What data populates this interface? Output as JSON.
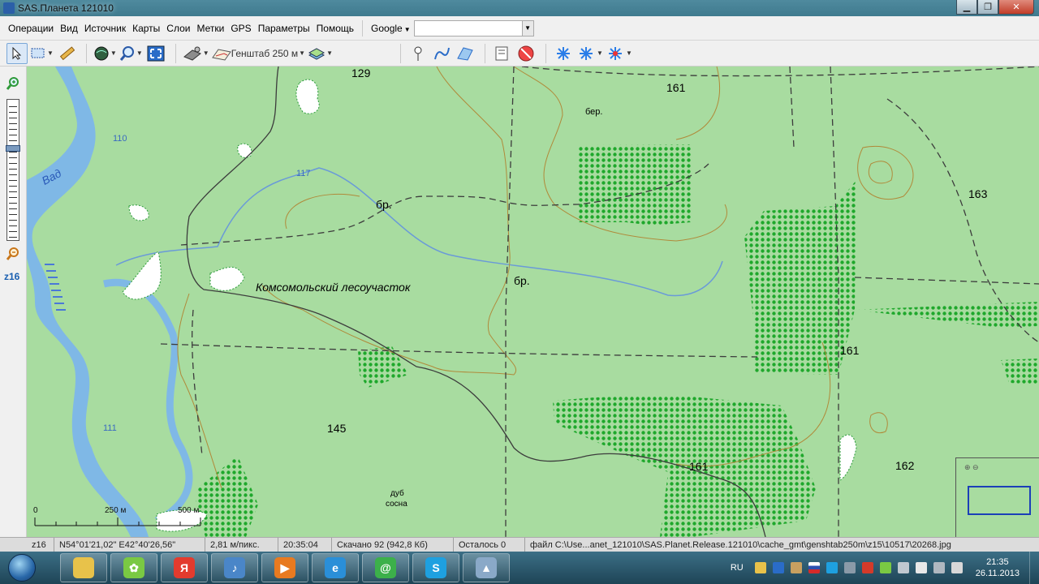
{
  "window": {
    "title": "SAS.Планета 121010"
  },
  "menu": {
    "items": [
      "Операции",
      "Вид",
      "Источник",
      "Карты",
      "Слои",
      "Метки",
      "GPS",
      "Параметры",
      "Помощь"
    ],
    "search_provider": "Google",
    "search_value": ""
  },
  "toolbar": {
    "map_type": "Генштаб 250 м",
    "icons": [
      "cursor-icon",
      "select-area-icon",
      "ruler-icon",
      "globe-icon",
      "zoom-lens-icon",
      "fullscreen-icon",
      "satellite-icon",
      "map-sheet-icon",
      "layers-icon",
      "placemark-icon",
      "path-icon",
      "polygon-icon",
      "marks-list-icon",
      "hide-marks-icon",
      "gps-icon",
      "gps-track-icon",
      "gps-settings-icon"
    ]
  },
  "side": {
    "zoom_label": "z16"
  },
  "map": {
    "labels": {
      "h129": "129",
      "h161a": "161",
      "h163": "163",
      "h161b": "161",
      "h161c": "161",
      "h162": "162",
      "h145": "145",
      "h110": "110",
      "h117": "117",
      "h111": "111",
      "river": "Вад",
      "ber": "бер.",
      "br1": "бр.",
      "br2": "бр.",
      "forest": "Комсомольский лесоучасток",
      "dub": "дуб",
      "sosna": "сосна"
    },
    "scale": {
      "zero": "0",
      "mid": "250 м",
      "end": "500 м"
    }
  },
  "status": {
    "zoom": "z16",
    "coords": "N54°01'21,02\" E42°40'26,56\"",
    "resolution": "2,81 м/пикс.",
    "time": "20:35:04",
    "downloaded": "Скачано 92 (942,8 Кб)",
    "remaining": "Осталось 0",
    "file": "файл C:\\Use...anet_121010\\SAS.Planet.Release.121010\\cache_gmt\\genshtab250m\\z15\\10517\\20268.jpg"
  },
  "taskbar": {
    "apps": [
      {
        "name": "explorer",
        "color": "#e8c24a",
        "glyph": ""
      },
      {
        "name": "icq",
        "color": "#7ac943",
        "glyph": "✿"
      },
      {
        "name": "yandex",
        "color": "#e33b2e",
        "glyph": "Я"
      },
      {
        "name": "audio",
        "color": "#4a86c8",
        "glyph": "♪"
      },
      {
        "name": "media",
        "color": "#e87a20",
        "glyph": "▶"
      },
      {
        "name": "ie",
        "color": "#2a8fd8",
        "glyph": "e"
      },
      {
        "name": "qip",
        "color": "#3cb04a",
        "glyph": "@"
      },
      {
        "name": "skype",
        "color": "#1ea0e0",
        "glyph": "S"
      },
      {
        "name": "sasplanet",
        "color": "#8aa9c8",
        "glyph": "▲"
      }
    ],
    "lang": "RU",
    "clock_time": "21:35",
    "clock_date": "26.11.2013"
  },
  "colors": {
    "map_bg": "#a8dca0",
    "forest": "#2fbe3a",
    "water": "#7fb8e6",
    "road": "#3c3c3c",
    "contour": "#b08a3a"
  }
}
